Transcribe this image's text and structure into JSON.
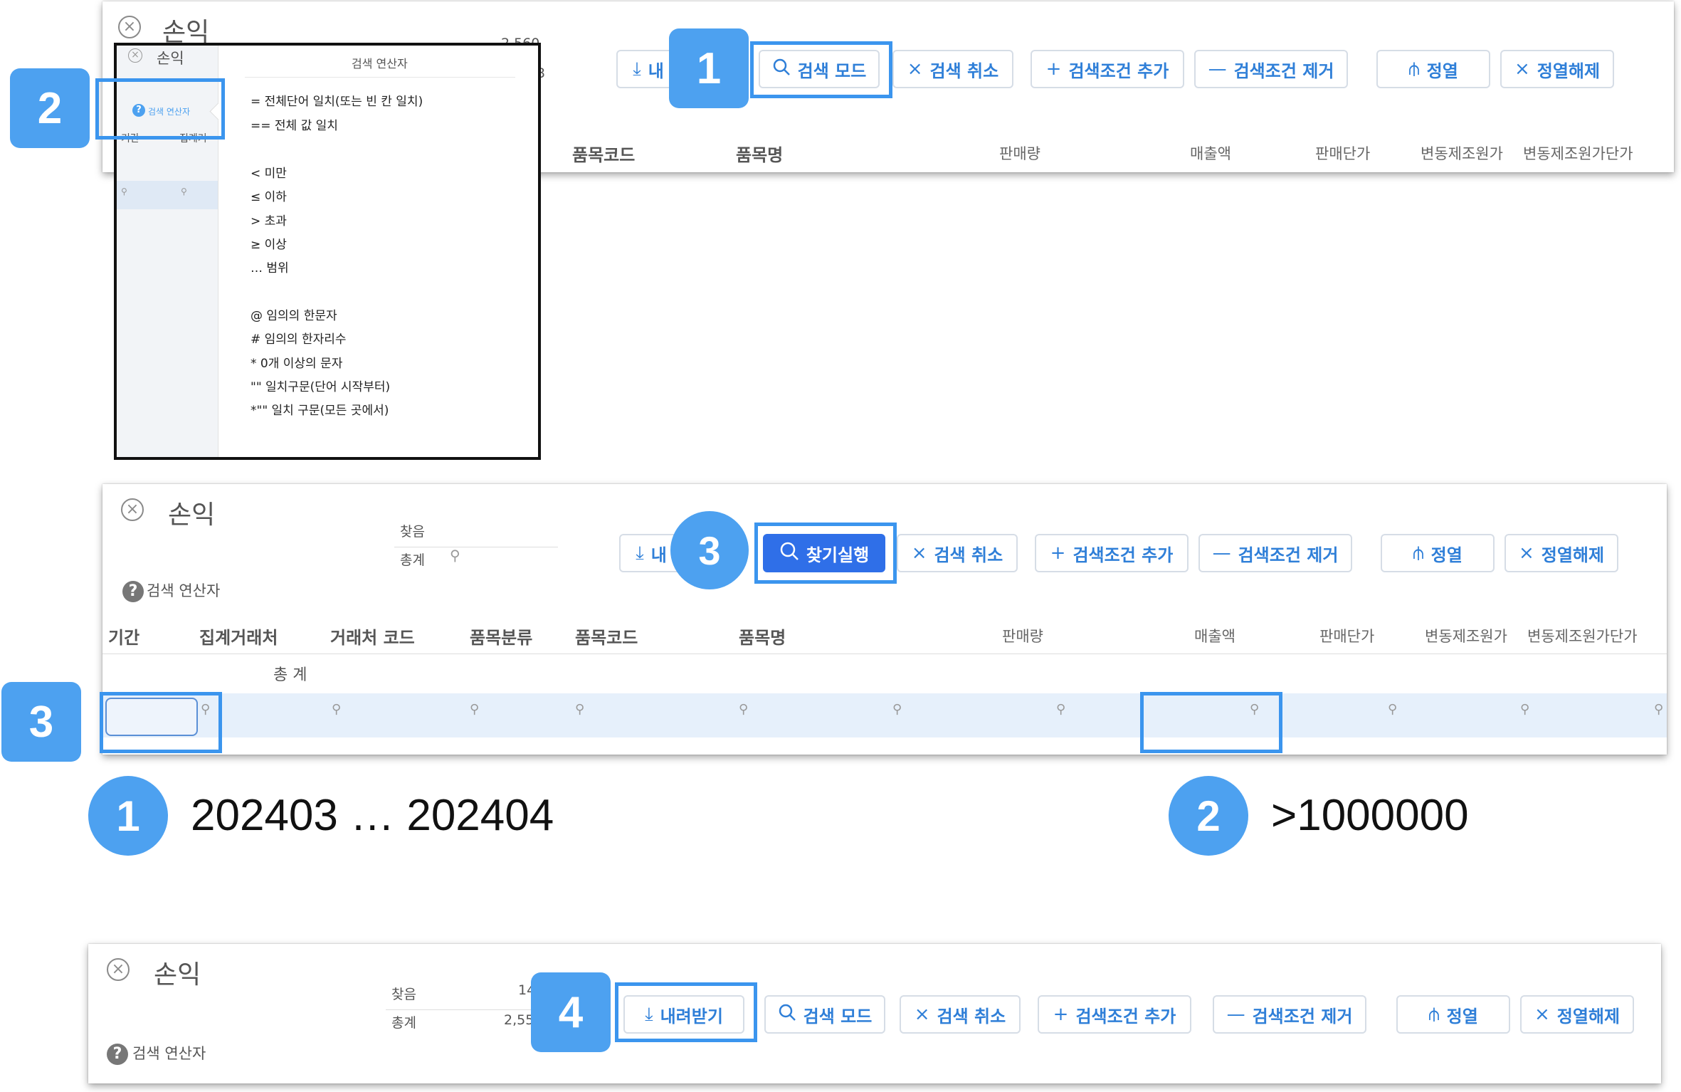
{
  "app_title": "손익",
  "toolbar": {
    "download": "내려받기",
    "download_partial": "내",
    "search_mode": "검색 모드",
    "search_cancel": "검색 취소",
    "add_condition": "검색조건 추가",
    "remove_condition": "검색조건 제거",
    "sort": "정열",
    "unsort": "정열해제",
    "find_run": "찾기실행"
  },
  "summary": {
    "found_label": "찾음",
    "total_label": "총계",
    "found_value_partial": "2,560",
    "total_value_partial": "3",
    "found_value_p3": "14",
    "total_value_p3": "2,55"
  },
  "operator_help_label": "검색 연산자",
  "columns": [
    "기간",
    "집계거래처",
    "거래처 코드",
    "품목분류",
    "품목코드",
    "품목명",
    "판매량",
    "매출액",
    "판매단가",
    "변동제조원가",
    "변동제조원가단가"
  ],
  "total_row_label": "총 계",
  "popup": {
    "title": "검색 연산자",
    "side_title": "손익",
    "side_label": "검색 연산자",
    "side_col1": "기간",
    "side_col2": "집계거",
    "lines": [
      "= 전체단어 일치(또는 빈 칸 일치)",
      "== 전체 값 일치",
      "< 미만",
      "≤ 이하",
      "> 초과",
      "≥ 이상",
      "… 범위",
      "@ 임의의 한문자",
      "# 임의의 한자리수",
      "* 0개 이상의 문자",
      "\"\" 일치구문(단어 시작부터)",
      "*\"\" 일치 구문(모든 곳에서)"
    ]
  },
  "steps": {
    "s1": "1",
    "s2": "2",
    "s3": "3",
    "s4": "4"
  },
  "examples": {
    "period": "202403 … 202404",
    "sales": ">1000000"
  },
  "colors": {
    "accent": "#4da1f0",
    "button_text": "#2f7fd8",
    "primary_button": "#2f6fe8",
    "filter_row": "#e6f0fb"
  }
}
